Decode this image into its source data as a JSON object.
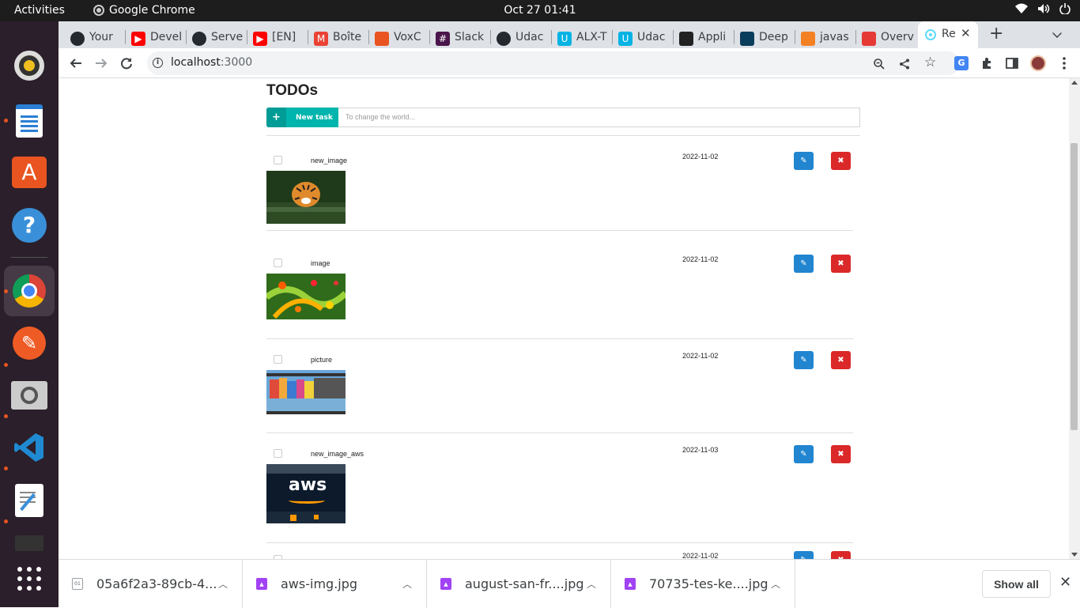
{
  "topbar": {
    "activities": "Activities",
    "app_name": "Google Chrome",
    "clock": "Oct 27  01:41"
  },
  "tabs": [
    {
      "label": "Your",
      "icon": "github-icon",
      "color": "#24292f"
    },
    {
      "label": "Devel",
      "icon": "youtube-icon",
      "color": "#ff0000"
    },
    {
      "label": "Serve",
      "icon": "github-icon",
      "color": "#24292f"
    },
    {
      "label": "[EN]",
      "icon": "youtube-icon",
      "color": "#ff0000"
    },
    {
      "label": "Boîte",
      "icon": "gmail-icon",
      "color": "#ea4335"
    },
    {
      "label": "VoxC",
      "icon": "voxcode-icon",
      "color": "#e95420"
    },
    {
      "label": "Slack",
      "icon": "slack-icon",
      "color": "#4a154b"
    },
    {
      "label": "Udac",
      "icon": "github-icon",
      "color": "#24292f"
    },
    {
      "label": "ALX-T",
      "icon": "udacity-icon",
      "color": "#02b3e4"
    },
    {
      "label": "Udac",
      "icon": "udacity-icon",
      "color": "#02b3e4"
    },
    {
      "label": "Appli",
      "icon": "ae-icon",
      "color": "#222222"
    },
    {
      "label": "Deep",
      "icon": "deepnote-icon",
      "color": "#0b3d5c"
    },
    {
      "label": "javas",
      "icon": "stackoverflow-icon",
      "color": "#f48024"
    },
    {
      "label": "Overv",
      "icon": "overview-icon",
      "color": "#e53935"
    }
  ],
  "active_tab": {
    "label": "Re",
    "icon": "react-icon"
  },
  "address": {
    "host": "localhost",
    "port": ":3000"
  },
  "page": {
    "title": "TODOs",
    "new_task_label": "New task",
    "input_placeholder": "To change the world..."
  },
  "todos": [
    {
      "name": "new_image",
      "date": "2022-11-02",
      "image": "tiger"
    },
    {
      "name": "image",
      "date": "2022-11-02",
      "image": "butterflies"
    },
    {
      "name": "picture",
      "date": "2022-11-02",
      "image": "colorful-houses"
    },
    {
      "name": "new_image_aws",
      "date": "2022-11-03",
      "image": "aws-sign"
    },
    {
      "name": "",
      "date": "2022-11-02",
      "image": ""
    }
  ],
  "aws_text": "aws",
  "downloads": {
    "items": [
      {
        "name": "05a6f2a3-89cb-4...",
        "icon": "binary-file-icon"
      },
      {
        "name": "aws-img.jpg",
        "icon": "image-file-icon"
      },
      {
        "name": "august-san-fr....jpg",
        "icon": "image-file-icon"
      },
      {
        "name": "70735-tes-ke....jpg",
        "icon": "image-file-icon"
      }
    ],
    "show_all": "Show all"
  },
  "colors": {
    "teal": "#00b5ad",
    "blue": "#2185d0",
    "red": "#db2828",
    "dock": "#2a1f2a"
  }
}
